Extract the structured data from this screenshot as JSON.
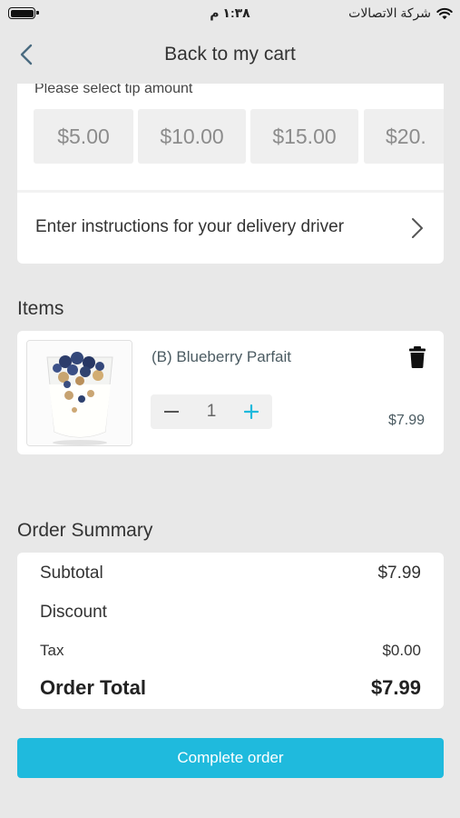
{
  "status_bar": {
    "carrier": "شركة الاتصالات",
    "time": "١:٣٨ م"
  },
  "header": {
    "title": "Back to my cart"
  },
  "tip": {
    "label": "Please select tip amount",
    "options": [
      "$5.00",
      "$10.00",
      "$15.00",
      "$20."
    ]
  },
  "driver": {
    "instructions_label": "Enter instructions for your delivery driver"
  },
  "items_section": {
    "title": "Items",
    "items": [
      {
        "name": "(B) Blueberry Parfait",
        "quantity": "1",
        "price": "$7.99"
      }
    ]
  },
  "order_summary": {
    "title": "Order Summary",
    "subtotal_label": "Subtotal",
    "subtotal_value": "$7.99",
    "discount_label": "Discount",
    "tax_label": "Tax",
    "tax_value": "$0.00",
    "total_label": "Order Total",
    "total_value": "$7.99"
  },
  "actions": {
    "complete_label": "Complete order"
  },
  "colors": {
    "accent": "#1fbadd",
    "background": "#e8e8e8"
  }
}
